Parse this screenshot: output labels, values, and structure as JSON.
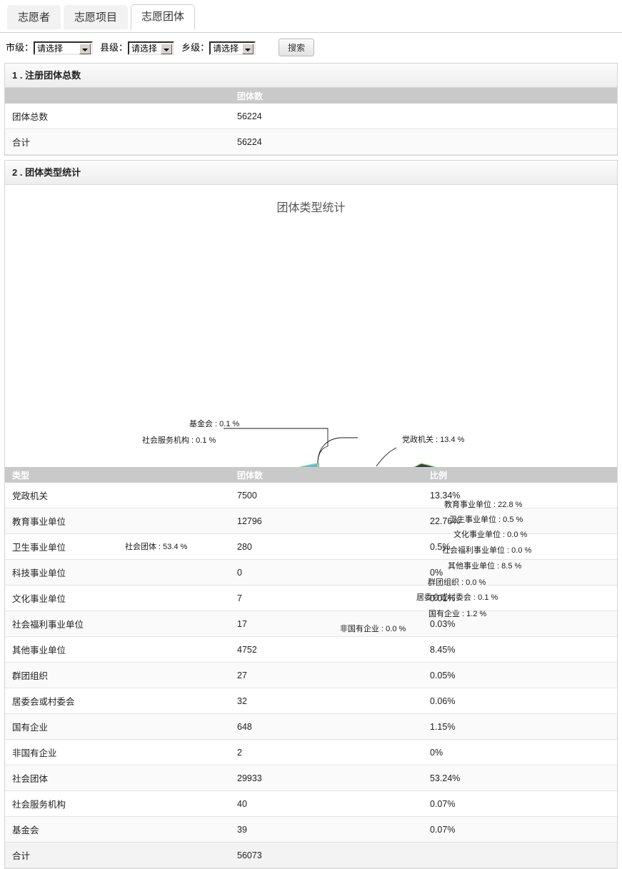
{
  "tabs": [
    {
      "label": "志愿者",
      "active": false
    },
    {
      "label": "志愿项目",
      "active": false
    },
    {
      "label": "志愿团体",
      "active": true
    }
  ],
  "filters": {
    "city": {
      "label": "市级：",
      "value": "请选择"
    },
    "county": {
      "label": "县级：",
      "value": "请选择"
    },
    "town": {
      "label": "乡级：",
      "value": "请选择"
    },
    "search_button": "搜索"
  },
  "section1": {
    "title": "1 . 注册团体总数",
    "columns": [
      "",
      "团体数"
    ],
    "rows": [
      {
        "name": "团体总数",
        "count": "56224"
      },
      {
        "name": "合计",
        "count": "56224"
      }
    ]
  },
  "section2": {
    "title": "2 . 团体类型统计",
    "columns": [
      "类型",
      "团体数",
      "比例"
    ],
    "rows": [
      {
        "type": "党政机关",
        "count": "7500",
        "ratio": "13.34%"
      },
      {
        "type": "教育事业单位",
        "count": "12796",
        "ratio": "22.76%"
      },
      {
        "type": "卫生事业单位",
        "count": "280",
        "ratio": "0.5%"
      },
      {
        "type": "科技事业单位",
        "count": "0",
        "ratio": "0%"
      },
      {
        "type": "文化事业单位",
        "count": "7",
        "ratio": "0.01%"
      },
      {
        "type": "社会福利事业单位",
        "count": "17",
        "ratio": "0.03%"
      },
      {
        "type": "其他事业单位",
        "count": "4752",
        "ratio": "8.45%"
      },
      {
        "type": "群团组织",
        "count": "27",
        "ratio": "0.05%"
      },
      {
        "type": "居委会或村委会",
        "count": "32",
        "ratio": "0.06%"
      },
      {
        "type": "国有企业",
        "count": "648",
        "ratio": "1.15%"
      },
      {
        "type": "非国有企业",
        "count": "2",
        "ratio": "0%"
      },
      {
        "type": "社会团体",
        "count": "29933",
        "ratio": "53.24%"
      },
      {
        "type": "社会服务机构",
        "count": "40",
        "ratio": "0.07%"
      },
      {
        "type": "基金会",
        "count": "39",
        "ratio": "0.07%"
      },
      {
        "type": "合计",
        "count": "56073",
        "ratio": ""
      }
    ]
  },
  "chart_data": {
    "type": "pie",
    "title": "团体类型统计",
    "legend_position": "callout-labels",
    "labels": [
      "基金会 : 0.1 %",
      "社会服务机构 : 0.1 %",
      "党政机关 : 13.4 %",
      "教育事业单位 : 22.8 %",
      "卫生事业单位 : 0.5 %",
      "文化事业单位 : 0.0 %",
      "社会福利事业单位 : 0.0 %",
      "其他事业单位 : 8.5 %",
      "群团组织 : 0.0 %",
      "居委会或村委会 : 0.1 %",
      "国有企业 : 1.2 %",
      "非国有企业 : 0.0 %",
      "社会团体 : 53.4 %"
    ],
    "categories": [
      "党政机关",
      "教育事业单位",
      "卫生事业单位",
      "科技事业单位",
      "文化事业单位",
      "社会福利事业单位",
      "其他事业单位",
      "群团组织",
      "居委会或村委会",
      "国有企业",
      "非国有企业",
      "社会团体",
      "社会服务机构",
      "基金会"
    ],
    "values": [
      13.4,
      22.8,
      0.5,
      0.0,
      0.0,
      0.0,
      8.5,
      0.0,
      0.1,
      1.2,
      0.0,
      53.4,
      0.1,
      0.1
    ],
    "counts": [
      7500,
      12796,
      280,
      0,
      7,
      17,
      4752,
      27,
      32,
      648,
      2,
      29933,
      40,
      39
    ],
    "colors": {
      "blue": "#6fb0e3",
      "dark": "#3c3c40",
      "pink": "#ea3f68",
      "green_border": "#8ede8e"
    }
  }
}
